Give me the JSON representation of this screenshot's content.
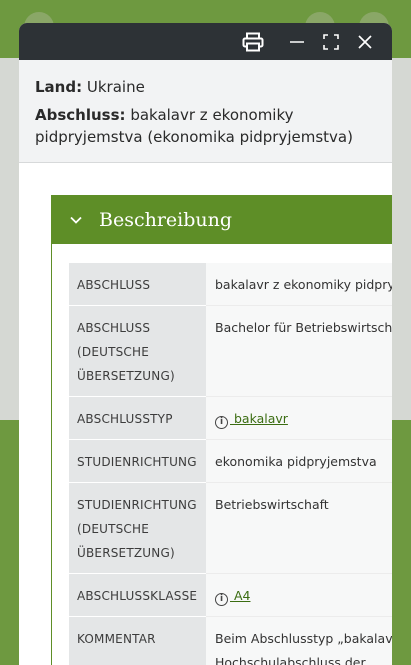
{
  "modal": {
    "icons": [
      "printer-icon",
      "minimize-icon",
      "fullscreen-icon",
      "close-icon"
    ],
    "info": {
      "land_label": "Land:",
      "land_value": "Ukraine",
      "abschluss_label": "Abschluss:",
      "abschluss_value": "bakalavr z ekonomiky pidpryjemstva (ekonomika pidpryjemstva)"
    },
    "section": {
      "title": "Beschreibung",
      "rows": [
        {
          "key": "ABSCHLUSS",
          "value": "bakalavr z ekonomiky pidpryjemstva"
        },
        {
          "key": "ABSCHLUSS (DEUTSCHE ÜBERSETZUNG)",
          "value": "Bachelor für Betriebswirtschaft"
        },
        {
          "key": "ABSCHLUSSTYP",
          "value": " bakalavr"
        },
        {
          "key": "STUDIENRICHTUNG",
          "value": "ekonomika pidpryjemstva"
        },
        {
          "key": "STUDIENRICHTUNG (DEUTSCHE ÜBERSETZUNG)",
          "value": "Betriebswirtschaft"
        },
        {
          "key": "ABSCHLUSSKLASSE",
          "value": " A4"
        },
        {
          "key": "KOMMENTAR",
          "value": "Beim Abschlusstyp „bakalavr“ handelt es sich um einen",
          "value2": "Hochschulabschluss der"
        }
      ]
    }
  }
}
